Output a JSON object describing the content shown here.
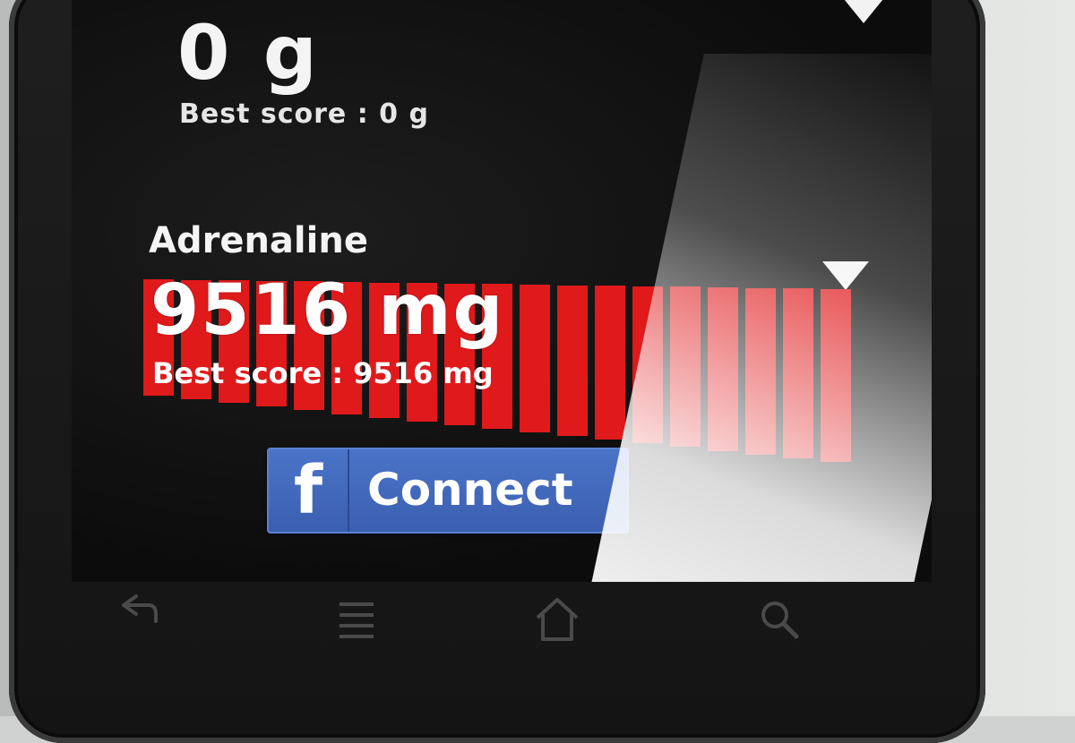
{
  "gforce": {
    "value": "0 g",
    "best_score": "Best score : 0 g"
  },
  "adrenaline": {
    "title": "Adrenaline",
    "value": "9516 mg",
    "best_score": "Best score : 9516 mg",
    "meter_segments_total": 19,
    "meter_level": 1.0
  },
  "facebook": {
    "logo": "f",
    "label": "Connect"
  },
  "navbar": {
    "keys": [
      "back-icon",
      "menu-icon",
      "home-icon",
      "search-icon"
    ]
  },
  "colors": {
    "meter_red": "#e0191b",
    "facebook_blue": "#3b5fb0"
  }
}
